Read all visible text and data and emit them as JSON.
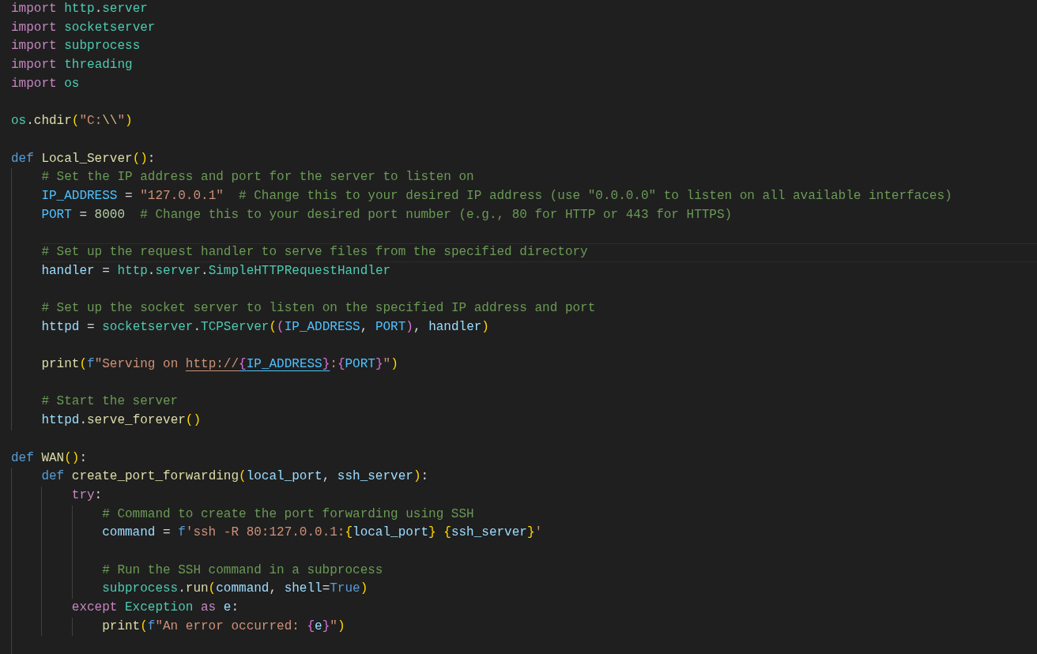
{
  "editor": {
    "lines": [
      {
        "kind": "code",
        "current": false,
        "tokens": [
          {
            "kind": "ctl",
            "text": "import "
          },
          {
            "kind": "mod",
            "text": "http"
          },
          {
            "kind": "txt",
            "text": "."
          },
          {
            "kind": "mod",
            "text": "server"
          }
        ]
      },
      {
        "kind": "code",
        "current": false,
        "tokens": [
          {
            "kind": "ctl",
            "text": "import "
          },
          {
            "kind": "mod",
            "text": "socketserver"
          }
        ]
      },
      {
        "kind": "code",
        "current": false,
        "tokens": [
          {
            "kind": "ctl",
            "text": "import "
          },
          {
            "kind": "mod",
            "text": "subprocess"
          }
        ]
      },
      {
        "kind": "code",
        "current": false,
        "tokens": [
          {
            "kind": "ctl",
            "text": "import "
          },
          {
            "kind": "mod",
            "text": "threading"
          }
        ]
      },
      {
        "kind": "code",
        "current": false,
        "tokens": [
          {
            "kind": "ctl",
            "text": "import "
          },
          {
            "kind": "mod",
            "text": "os"
          }
        ]
      },
      {
        "kind": "blank",
        "current": false
      },
      {
        "kind": "code",
        "current": false,
        "tokens": [
          {
            "kind": "mod",
            "text": "os"
          },
          {
            "kind": "txt",
            "text": "."
          },
          {
            "kind": "fn",
            "text": "chdir"
          },
          {
            "kind": "b1",
            "text": "("
          },
          {
            "kind": "str",
            "text": "\"C:"
          },
          {
            "kind": "esc",
            "text": "\\\\"
          },
          {
            "kind": "str",
            "text": "\""
          },
          {
            "kind": "b1",
            "text": ")"
          }
        ]
      },
      {
        "kind": "blank",
        "current": false
      },
      {
        "kind": "code",
        "current": false,
        "tokens": [
          {
            "kind": "kw",
            "text": "def "
          },
          {
            "kind": "fn",
            "text": "Local_Server"
          },
          {
            "kind": "b1",
            "text": "()"
          },
          {
            "kind": "txt",
            "text": ":"
          }
        ],
        "children": [
          {
            "kind": "code",
            "current": false,
            "tokens": [
              {
                "kind": "cmt",
                "text": "# Set the IP address and port for the server to listen on"
              }
            ]
          },
          {
            "kind": "code",
            "current": false,
            "tokens": [
              {
                "kind": "const",
                "text": "IP_ADDRESS"
              },
              {
                "kind": "txt",
                "text": " = "
              },
              {
                "kind": "str",
                "text": "\"127.0.0.1\"  "
              },
              {
                "kind": "cmt",
                "text": "# Change this to your desired IP address (use \"0.0.0.0\" to listen on all available interfaces)"
              }
            ]
          },
          {
            "kind": "code",
            "current": false,
            "tokens": [
              {
                "kind": "const",
                "text": "PORT"
              },
              {
                "kind": "txt",
                "text": " = "
              },
              {
                "kind": "num",
                "text": "8000  "
              },
              {
                "kind": "cmt",
                "text": "# Change this to your desired port number (e.g., 80 for HTTP or 443 for HTTPS)"
              }
            ]
          },
          {
            "kind": "blank",
            "current": false
          },
          {
            "kind": "code",
            "current": true,
            "tokens": [
              {
                "kind": "cmt",
                "text": "# Set up the request handler to serve files from the specified directory"
              }
            ]
          },
          {
            "kind": "code",
            "current": false,
            "tokens": [
              {
                "kind": "var",
                "text": "handler"
              },
              {
                "kind": "txt",
                "text": " = "
              },
              {
                "kind": "mod",
                "text": "http"
              },
              {
                "kind": "txt",
                "text": "."
              },
              {
                "kind": "mod",
                "text": "server"
              },
              {
                "kind": "txt",
                "text": "."
              },
              {
                "kind": "mod",
                "text": "SimpleHTTPRequestHandler"
              }
            ]
          },
          {
            "kind": "blank",
            "current": false
          },
          {
            "kind": "code",
            "current": false,
            "tokens": [
              {
                "kind": "cmt",
                "text": "# Set up the socket server to listen on the specified IP address and port"
              }
            ]
          },
          {
            "kind": "code",
            "current": false,
            "tokens": [
              {
                "kind": "var",
                "text": "httpd"
              },
              {
                "kind": "txt",
                "text": " = "
              },
              {
                "kind": "mod",
                "text": "socketserver"
              },
              {
                "kind": "txt",
                "text": "."
              },
              {
                "kind": "mod",
                "text": "TCPServer"
              },
              {
                "kind": "b1",
                "text": "("
              },
              {
                "kind": "b2",
                "text": "("
              },
              {
                "kind": "const",
                "text": "IP_ADDRESS"
              },
              {
                "kind": "txt",
                "text": ", "
              },
              {
                "kind": "const",
                "text": "PORT"
              },
              {
                "kind": "b2",
                "text": ")"
              },
              {
                "kind": "txt",
                "text": ", "
              },
              {
                "kind": "var",
                "text": "handler"
              },
              {
                "kind": "b1",
                "text": ")"
              }
            ]
          },
          {
            "kind": "blank",
            "current": false
          },
          {
            "kind": "code",
            "current": false,
            "tokens": [
              {
                "kind": "fn",
                "text": "print"
              },
              {
                "kind": "b1",
                "text": "("
              },
              {
                "kind": "kw",
                "text": "f"
              },
              {
                "kind": "str",
                "text": "\"Serving on "
              },
              {
                "kind": "linkstr",
                "text": "http://"
              },
              {
                "kind": "linkb",
                "text": "{"
              },
              {
                "kind": "linkconst",
                "text": "IP_ADDRESS"
              },
              {
                "kind": "linkb",
                "text": "}"
              },
              {
                "kind": "str",
                "text": ":"
              },
              {
                "kind": "b2",
                "text": "{"
              },
              {
                "kind": "const",
                "text": "PORT"
              },
              {
                "kind": "b2",
                "text": "}"
              },
              {
                "kind": "str",
                "text": "\""
              },
              {
                "kind": "b1",
                "text": ")"
              }
            ]
          },
          {
            "kind": "blank",
            "current": false
          },
          {
            "kind": "code",
            "current": false,
            "tokens": [
              {
                "kind": "cmt",
                "text": "# Start the server"
              }
            ]
          },
          {
            "kind": "code",
            "current": false,
            "tokens": [
              {
                "kind": "var",
                "text": "httpd"
              },
              {
                "kind": "txt",
                "text": "."
              },
              {
                "kind": "fn",
                "text": "serve_forever"
              },
              {
                "kind": "b1",
                "text": "()"
              }
            ]
          }
        ]
      },
      {
        "kind": "blank",
        "current": false
      },
      {
        "kind": "code",
        "current": false,
        "tokens": [
          {
            "kind": "kw",
            "text": "def "
          },
          {
            "kind": "fn",
            "text": "WAN"
          },
          {
            "kind": "b1",
            "text": "()"
          },
          {
            "kind": "txt",
            "text": ":"
          }
        ],
        "children": [
          {
            "kind": "code",
            "current": false,
            "tokens": [
              {
                "kind": "kw",
                "text": "def "
              },
              {
                "kind": "fn",
                "text": "create_port_forwarding"
              },
              {
                "kind": "b1",
                "text": "("
              },
              {
                "kind": "var",
                "text": "local_port"
              },
              {
                "kind": "txt",
                "text": ", "
              },
              {
                "kind": "var",
                "text": "ssh_server"
              },
              {
                "kind": "b1",
                "text": ")"
              },
              {
                "kind": "txt",
                "text": ":"
              }
            ],
            "children": [
              {
                "kind": "code",
                "current": false,
                "tokens": [
                  {
                    "kind": "ctl",
                    "text": "try"
                  },
                  {
                    "kind": "txt",
                    "text": ":"
                  }
                ],
                "children": [
                  {
                    "kind": "code",
                    "current": false,
                    "tokens": [
                      {
                        "kind": "cmt",
                        "text": "# Command to create the port forwarding using SSH"
                      }
                    ]
                  },
                  {
                    "kind": "code",
                    "current": false,
                    "tokens": [
                      {
                        "kind": "var",
                        "text": "command"
                      },
                      {
                        "kind": "txt",
                        "text": " = "
                      },
                      {
                        "kind": "kw",
                        "text": "f"
                      },
                      {
                        "kind": "str",
                        "text": "'ssh -R 80:127.0.0.1:"
                      },
                      {
                        "kind": "b1",
                        "text": "{"
                      },
                      {
                        "kind": "var",
                        "text": "local_port"
                      },
                      {
                        "kind": "b1",
                        "text": "} {"
                      },
                      {
                        "kind": "var",
                        "text": "ssh_server"
                      },
                      {
                        "kind": "b1",
                        "text": "}"
                      },
                      {
                        "kind": "str",
                        "text": "'"
                      }
                    ]
                  },
                  {
                    "kind": "blank",
                    "current": false
                  },
                  {
                    "kind": "code",
                    "current": false,
                    "tokens": [
                      {
                        "kind": "cmt",
                        "text": "# Run the SSH command in a subprocess"
                      }
                    ]
                  },
                  {
                    "kind": "code",
                    "current": false,
                    "tokens": [
                      {
                        "kind": "mod",
                        "text": "subprocess"
                      },
                      {
                        "kind": "txt",
                        "text": "."
                      },
                      {
                        "kind": "fn",
                        "text": "run"
                      },
                      {
                        "kind": "b1",
                        "text": "("
                      },
                      {
                        "kind": "var",
                        "text": "command"
                      },
                      {
                        "kind": "txt",
                        "text": ", "
                      },
                      {
                        "kind": "var",
                        "text": "shell"
                      },
                      {
                        "kind": "txt",
                        "text": "="
                      },
                      {
                        "kind": "kw",
                        "text": "True"
                      },
                      {
                        "kind": "b1",
                        "text": ")"
                      }
                    ]
                  }
                ]
              },
              {
                "kind": "code",
                "current": false,
                "tokens": [
                  {
                    "kind": "ctl",
                    "text": "except "
                  },
                  {
                    "kind": "mod",
                    "text": "Exception "
                  },
                  {
                    "kind": "ctl",
                    "text": "as "
                  },
                  {
                    "kind": "var",
                    "text": "e"
                  },
                  {
                    "kind": "txt",
                    "text": ":"
                  }
                ],
                "children": [
                  {
                    "kind": "code",
                    "current": false,
                    "tokens": [
                      {
                        "kind": "fn",
                        "text": "print"
                      },
                      {
                        "kind": "b1",
                        "text": "("
                      },
                      {
                        "kind": "kw",
                        "text": "f"
                      },
                      {
                        "kind": "str",
                        "text": "\"An error occurred: "
                      },
                      {
                        "kind": "b2",
                        "text": "{"
                      },
                      {
                        "kind": "var",
                        "text": "e"
                      },
                      {
                        "kind": "b2",
                        "text": "}"
                      },
                      {
                        "kind": "str",
                        "text": "\""
                      },
                      {
                        "kind": "b1",
                        "text": ")"
                      }
                    ]
                  }
                ]
              }
            ]
          },
          {
            "kind": "blank",
            "current": false
          }
        ]
      }
    ]
  }
}
